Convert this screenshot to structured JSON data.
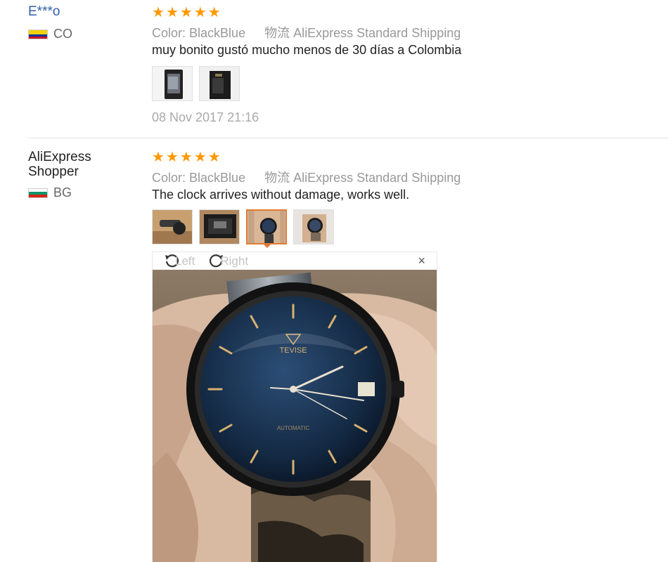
{
  "reviews": [
    {
      "user": "E***o",
      "country": "CO",
      "stars": 5,
      "color_label": "Color:",
      "color_value": "BlackBlue",
      "shipping_label": "物流",
      "shipping_value": "AliExpress Standard Shipping",
      "text": "muy bonito gustó mucho menos de 30 días a Colombia",
      "date": "08 Nov 2017 21:16",
      "photo_count": 2
    },
    {
      "user_line1": "AliExpress",
      "user_line2": "Shopper",
      "country": "BG",
      "stars": 5,
      "color_label": "Color:",
      "color_value": "BlackBlue",
      "shipping_label": "物流",
      "shipping_value": "AliExpress Standard Shipping",
      "text": "The clock arrives without damage, works well.",
      "photo_count": 4,
      "selected_photo": 3
    }
  ],
  "viewer": {
    "rotate_left": "Left",
    "rotate_right": "Right",
    "close": "×",
    "watch_brand": "TEVISE",
    "watch_type": "AUTOMATIC"
  },
  "colors": {
    "star": "#ff9900",
    "active_thumb": "#e07a35",
    "username_link": "#2f5fa8"
  }
}
